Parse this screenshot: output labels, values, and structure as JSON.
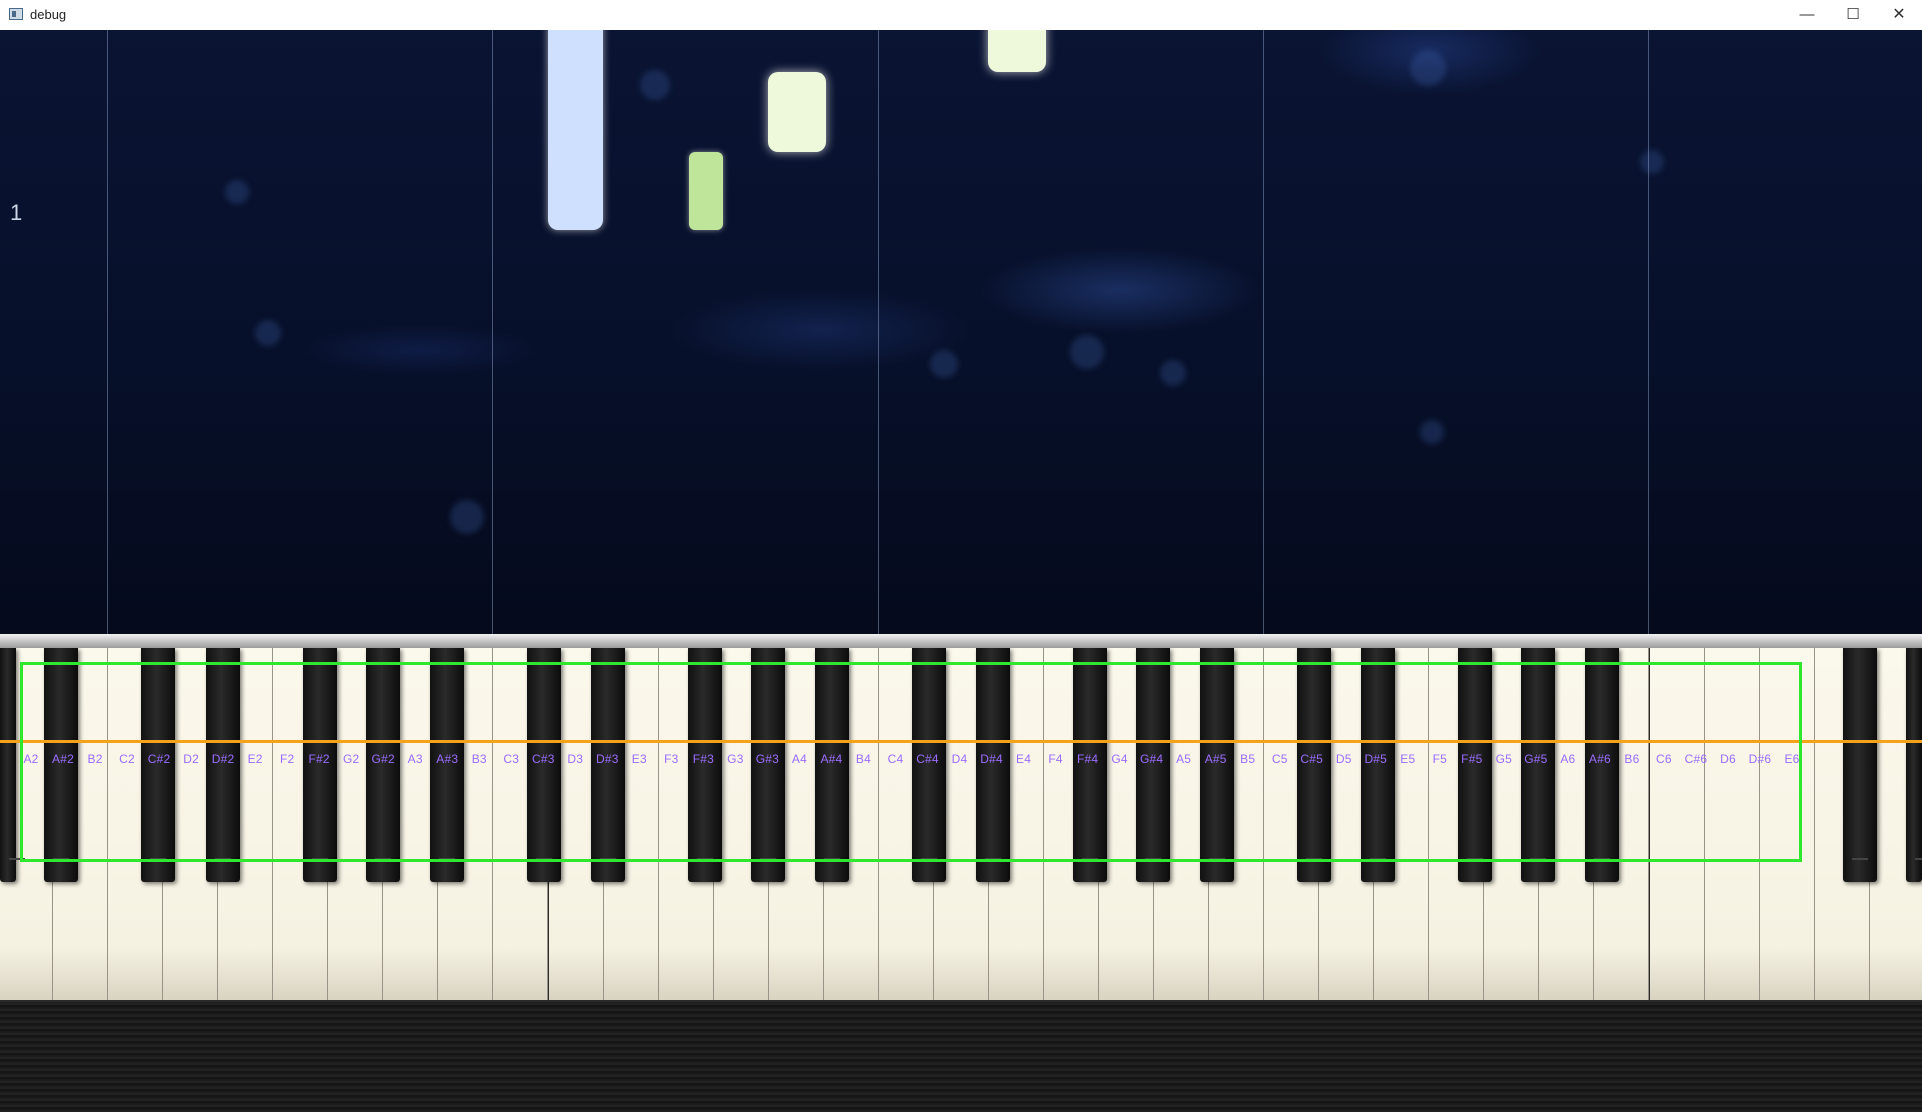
{
  "window": {
    "title": "debug",
    "controls": {
      "minimize": "—",
      "maximize": "☐",
      "close": "✕"
    }
  },
  "stage": {
    "counter": "1"
  },
  "colors": {
    "detection_box": "#2ee82e",
    "scan_line": "#f3a21a",
    "key_label": "#9a6cff",
    "note_blue": "#cfe0ff",
    "note_green": "#bfe59a",
    "note_pale": "#eef9dc"
  },
  "key_labels": [
    "A2",
    "A#2",
    "B2",
    "C2",
    "C#2",
    "D2",
    "D#2",
    "E2",
    "F2",
    "F#2",
    "G2",
    "G#2",
    "A3",
    "A#3",
    "B3",
    "C3",
    "C#3",
    "D3",
    "D#3",
    "E3",
    "F3",
    "F#3",
    "G3",
    "G#3",
    "A4",
    "A#4",
    "B4",
    "C4",
    "C#4",
    "D4",
    "D#4",
    "E4",
    "F4",
    "F#4",
    "G4",
    "G#4",
    "A5",
    "A#5",
    "B5",
    "C5",
    "C#5",
    "D5",
    "D#5",
    "E5",
    "F5",
    "F#5",
    "G5",
    "G#5",
    "A6",
    "A#6",
    "B6",
    "C6",
    "C#6",
    "D6",
    "D#6",
    "E6"
  ]
}
